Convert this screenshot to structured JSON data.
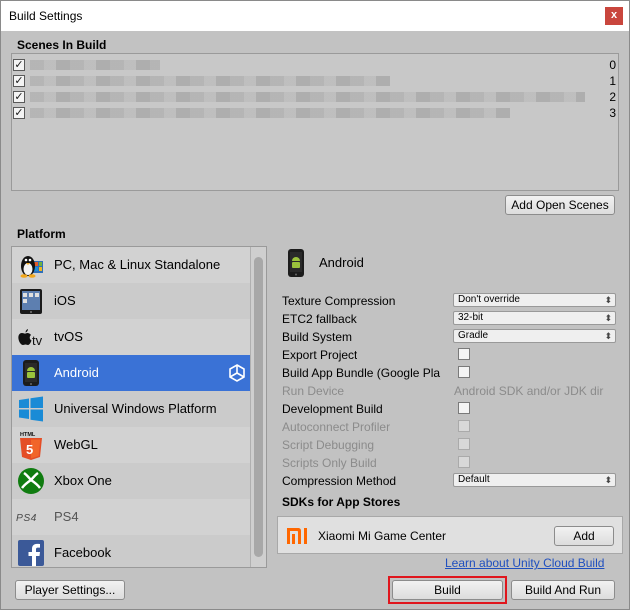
{
  "window": {
    "title": "Build Settings",
    "close_label": "x"
  },
  "scenes": {
    "label": "Scenes In Build",
    "rows": [
      {
        "index": "0",
        "checked": true
      },
      {
        "index": "1",
        "checked": true
      },
      {
        "index": "2",
        "checked": true
      },
      {
        "index": "3",
        "checked": true
      }
    ],
    "add_open_scenes_label": "Add Open Scenes"
  },
  "platform": {
    "label": "Platform",
    "items": [
      {
        "label": "PC, Mac & Linux Standalone",
        "icon": "linux-tux-icon"
      },
      {
        "label": "iOS",
        "icon": "ipad-icon"
      },
      {
        "label": "tvOS",
        "icon": "apple-tv-icon"
      },
      {
        "label": "Android",
        "icon": "android-phone-icon",
        "selected": true
      },
      {
        "label": "Universal Windows Platform",
        "icon": "windows-icon"
      },
      {
        "label": "WebGL",
        "icon": "html5-icon"
      },
      {
        "label": "Xbox One",
        "icon": "xbox-icon"
      },
      {
        "label": "PS4",
        "icon": "ps4-icon"
      },
      {
        "label": "Facebook",
        "icon": "facebook-icon"
      }
    ]
  },
  "settings": {
    "platform_name": "Android",
    "texture_compression": {
      "label": "Texture Compression",
      "value": "Don't override"
    },
    "etc2_fallback": {
      "label": "ETC2 fallback",
      "value": "32-bit"
    },
    "build_system": {
      "label": "Build System",
      "value": "Gradle"
    },
    "export_project": {
      "label": "Export Project"
    },
    "build_app_bundle": {
      "label": "Build App Bundle (Google Pla"
    },
    "run_device": {
      "label": "Run Device",
      "value": "Android SDK and/or JDK dir"
    },
    "development_build": {
      "label": "Development Build"
    },
    "autoconnect_profiler": {
      "label": "Autoconnect Profiler"
    },
    "script_debugging": {
      "label": "Script Debugging"
    },
    "scripts_only_build": {
      "label": "Scripts Only Build"
    },
    "compression_method": {
      "label": "Compression Method",
      "value": "Default"
    },
    "sdks_label": "SDKs for App Stores",
    "sdk_name": "Xiaomi Mi Game Center",
    "add_label": "Add",
    "cloud_build_link": "Learn about Unity Cloud Build"
  },
  "footer": {
    "player_settings_label": "Player Settings...",
    "build_label": "Build",
    "build_and_run_label": "Build And Run"
  },
  "colors": {
    "selection": "#3a72d6",
    "highlight": "#e0161d",
    "link": "#1f4fbf"
  }
}
